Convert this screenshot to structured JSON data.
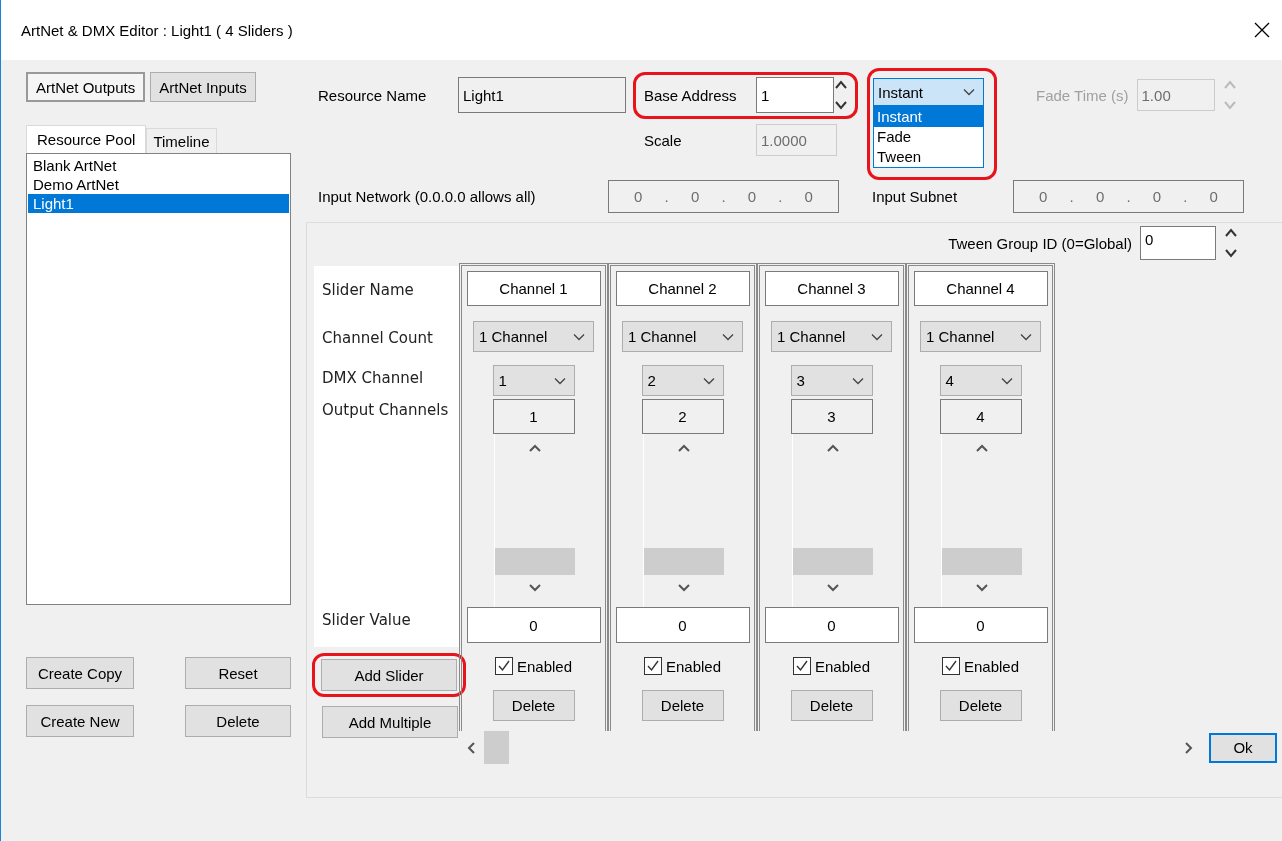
{
  "window": {
    "title": "ArtNet & DMX Editor : Light1 ( 4 Sliders )"
  },
  "mode_buttons": [
    {
      "label": "ArtNet Outputs",
      "selected": true
    },
    {
      "label": "ArtNet Inputs",
      "selected": false
    }
  ],
  "tabs": [
    {
      "label": "Resource Pool",
      "selected": true
    },
    {
      "label": "Timeline",
      "selected": false
    }
  ],
  "resources": [
    {
      "label": "Blank ArtNet",
      "selected": false
    },
    {
      "label": "Demo ArtNet",
      "selected": false
    },
    {
      "label": "Light1",
      "selected": true
    }
  ],
  "pool_buttons": [
    "Create Copy",
    "Reset",
    "Create New",
    "Delete"
  ],
  "resource_name": {
    "label": "Resource Name",
    "value": "Light1"
  },
  "base_address": {
    "label": "Base Address",
    "value": "1",
    "highlighted": true
  },
  "transition": {
    "value": "Instant",
    "expanded": true,
    "highlighted": true,
    "options": [
      {
        "label": "Instant",
        "selected": true
      },
      {
        "label": "Fade",
        "selected": false
      },
      {
        "label": "Tween",
        "selected": false
      }
    ]
  },
  "fade_time": {
    "label": "Fade Time (s)",
    "value": "1.00",
    "disabled": true
  },
  "scale": {
    "label": "Scale",
    "value": "1.0000"
  },
  "input_network": {
    "label": "Input Network (0.0.0.0 allows all)",
    "octets": [
      "0",
      "0",
      "0",
      "0"
    ],
    "separator": "."
  },
  "input_subnet": {
    "label": "Input Subnet",
    "octets": [
      "0",
      "0",
      "0",
      "0"
    ],
    "separator": "."
  },
  "tween_group": {
    "label": "Tween Group ID (0=Global)",
    "value": "0"
  },
  "row_labels": [
    "Slider Name",
    "Channel Count",
    "DMX Channel",
    "Output Channels",
    "Slider Value"
  ],
  "sliders": [
    {
      "name": "Channel 1",
      "channel_count": "1 Channel",
      "dmx_channel": "1",
      "output_channels": "1",
      "value": "0",
      "enabled": true,
      "enabled_label": "Enabled",
      "delete": "Delete"
    },
    {
      "name": "Channel 2",
      "channel_count": "1 Channel",
      "dmx_channel": "2",
      "output_channels": "2",
      "value": "0",
      "enabled": true,
      "enabled_label": "Enabled",
      "delete": "Delete"
    },
    {
      "name": "Channel 3",
      "channel_count": "1 Channel",
      "dmx_channel": "3",
      "output_channels": "3",
      "value": "0",
      "enabled": true,
      "enabled_label": "Enabled",
      "delete": "Delete"
    },
    {
      "name": "Channel 4",
      "channel_count": "1 Channel",
      "dmx_channel": "4",
      "output_channels": "4",
      "value": "0",
      "enabled": true,
      "enabled_label": "Enabled",
      "delete": "Delete"
    }
  ],
  "add_buttons": [
    {
      "label": "Add Slider",
      "highlighted": true
    },
    {
      "label": "Add Multiple",
      "highlighted": false
    }
  ],
  "ok_button": "Ok"
}
